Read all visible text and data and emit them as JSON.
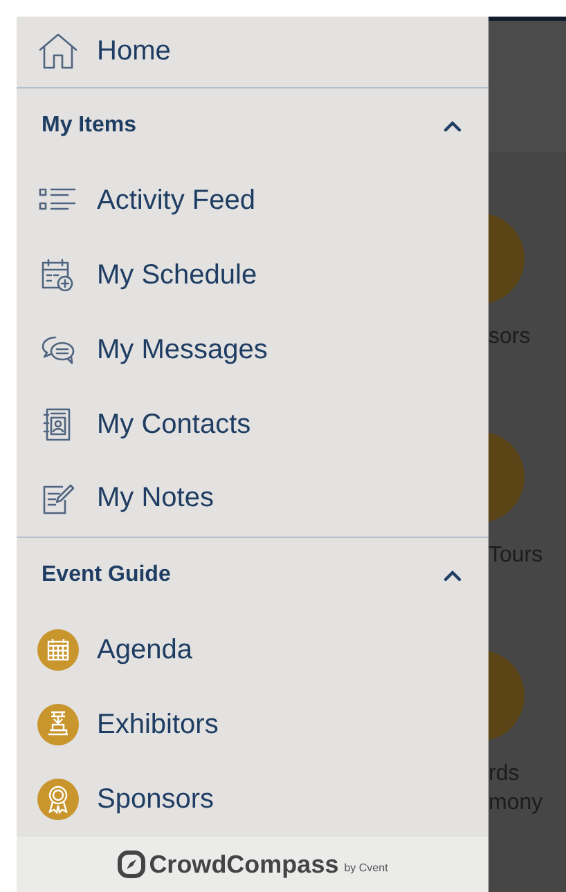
{
  "menu": {
    "home": {
      "label": "Home"
    },
    "sections": [
      {
        "title": "My Items",
        "expanded": true,
        "items": [
          {
            "label": "Activity Feed"
          },
          {
            "label": "My Schedule"
          },
          {
            "label": "My Messages"
          },
          {
            "label": "My Contacts"
          },
          {
            "label": "My Notes"
          }
        ]
      },
      {
        "title": "Event Guide",
        "expanded": true,
        "items": [
          {
            "label": "Agenda"
          },
          {
            "label": "Exhibitors"
          },
          {
            "label": "Sponsors"
          }
        ]
      }
    ]
  },
  "footer": {
    "brand": "CrowdCompass",
    "byline": "by Cvent"
  },
  "background": {
    "tiles": [
      {
        "label_lines": [
          "sors"
        ]
      },
      {
        "label_lines": [
          "Tours"
        ]
      },
      {
        "label_lines": [
          "rds",
          "mony"
        ]
      }
    ]
  }
}
